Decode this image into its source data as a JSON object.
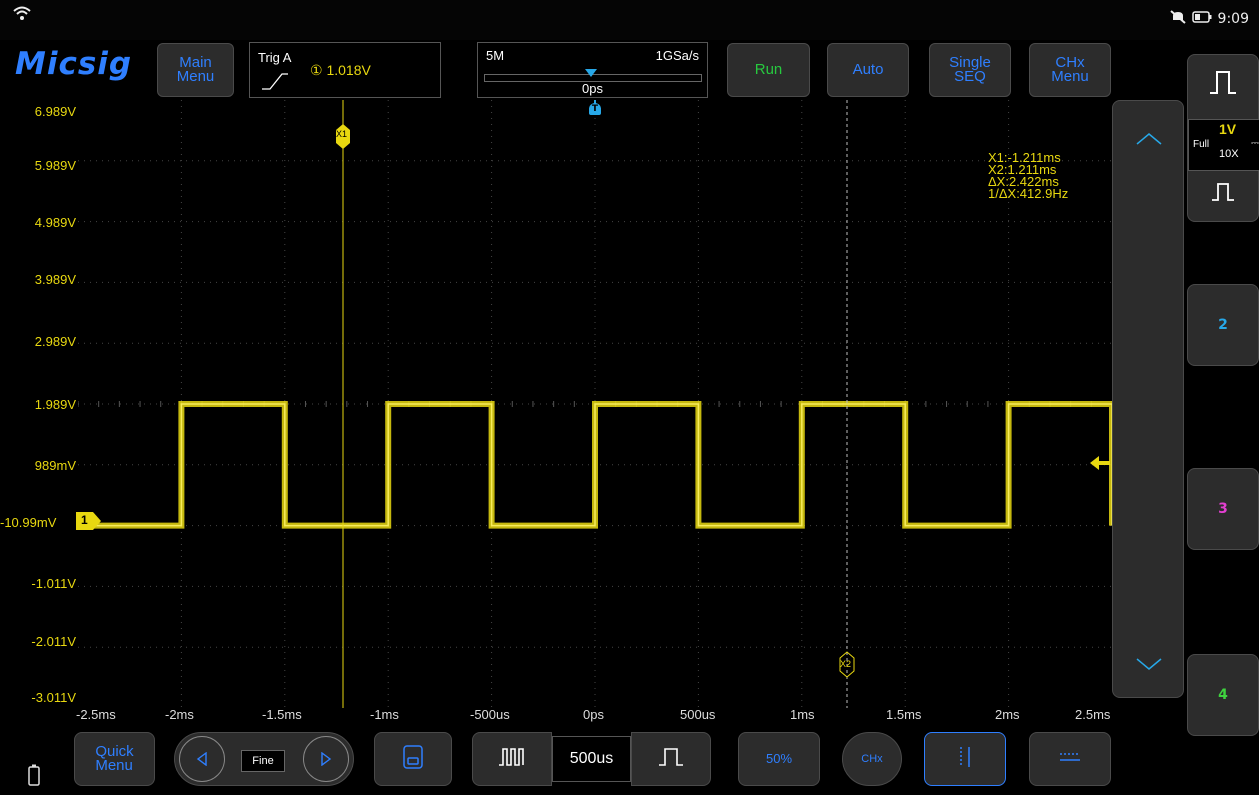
{
  "status": {
    "time": "9:09"
  },
  "logo": "Micsig",
  "toolbar": {
    "main_menu": "Main\nMenu",
    "run": "Run",
    "auto": "Auto",
    "single_seq": "Single\nSEQ",
    "chx_menu": "CHx\nMenu"
  },
  "trigger": {
    "label": "Trig A",
    "value": "① 1.018V"
  },
  "timebase": {
    "memory": "5M",
    "sample_rate": "1GSa/s",
    "delay": "0ps"
  },
  "y_axis": [
    "6.989V",
    "5.989V",
    "4.989V",
    "3.989V",
    "2.989V",
    "1.989V",
    "989mV",
    "-10.99mV",
    "-1.011V",
    "-2.011V",
    "-3.011V"
  ],
  "x_axis": [
    "-2.5ms",
    "-2ms",
    "-1.5ms",
    "-1ms",
    "-500us",
    "0ps",
    "500us",
    "1ms",
    "1.5ms",
    "2ms",
    "2.5ms"
  ],
  "cursors": {
    "x1_label": "X1",
    "x2_label": "X2",
    "readout": [
      "X1:-1.211ms",
      "X2:1.211ms",
      "ΔX:2.422ms",
      "1/ΔX:412.9Hz"
    ]
  },
  "channel1": {
    "marker": "1",
    "scale": "1V",
    "coupling": "Full",
    "probe": "10X"
  },
  "side_channels": [
    "2",
    "3",
    "4"
  ],
  "bottom": {
    "quick_menu": "Quick\nMenu",
    "fine": "Fine",
    "timebase_value": "500us",
    "fifty_percent": "50%",
    "chx": "CHx"
  },
  "waveform": {
    "high_v": 1.989,
    "low_v": -0.01099,
    "period_ms": 1.0,
    "first_rise_ms": -2.0,
    "duty": 0.5
  },
  "colors": {
    "accent": "#2f7fff",
    "channel1": "#e8d810",
    "run": "#27c93f",
    "ch2": "#27a8e8",
    "ch3": "#e23fd0",
    "ch4": "#3fd23f"
  }
}
